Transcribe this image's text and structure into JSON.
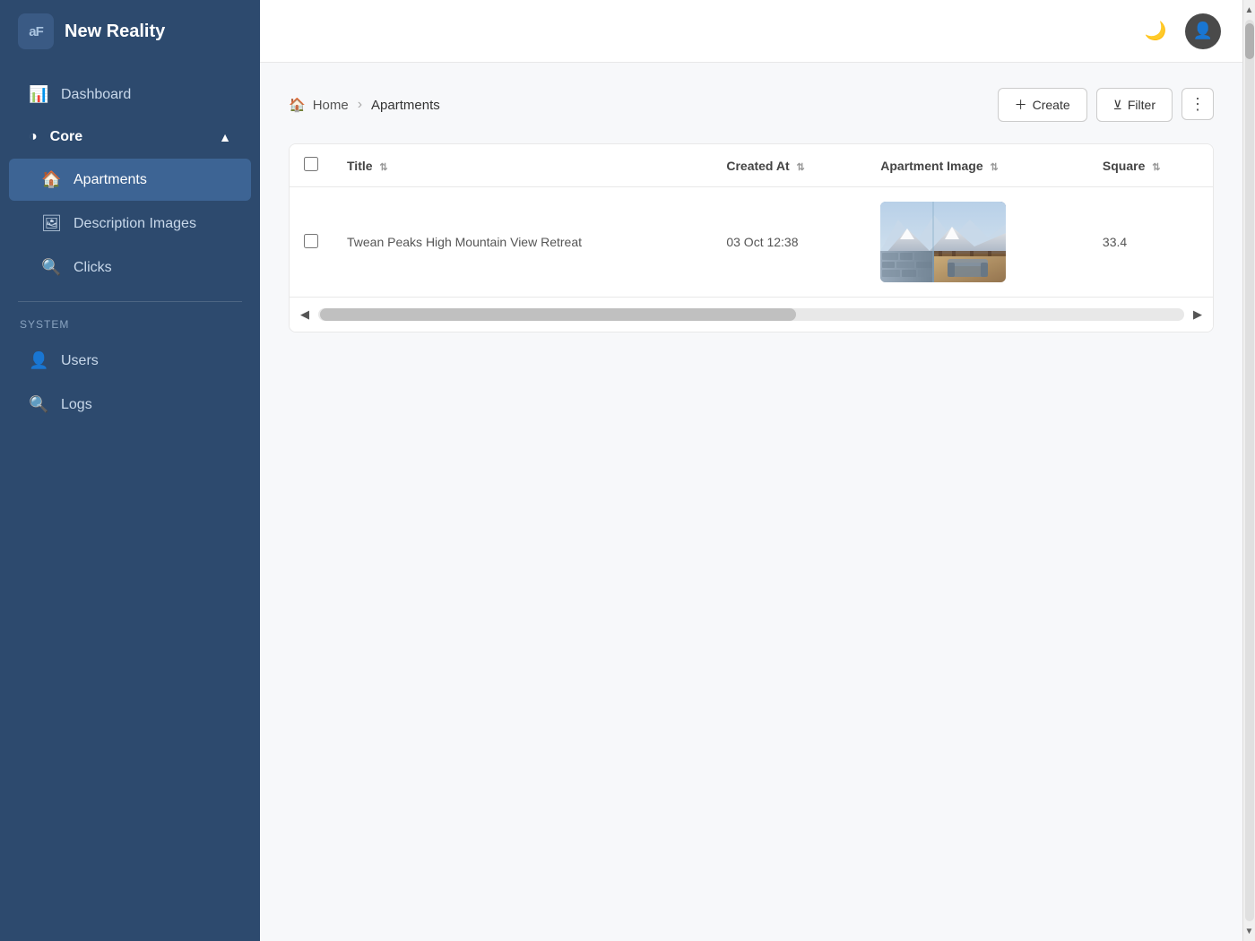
{
  "app": {
    "logo_text": "aF",
    "title": "New Reality"
  },
  "sidebar": {
    "nav_items": [
      {
        "id": "dashboard",
        "label": "Dashboard",
        "icon": "📊",
        "active": false
      },
      {
        "id": "core",
        "label": "Core",
        "icon": "◑",
        "active": false,
        "expandable": true,
        "expanded": true
      },
      {
        "id": "apartments",
        "label": "Apartments",
        "icon": "🏠",
        "active": true,
        "indent": true
      },
      {
        "id": "description-images",
        "label": "Description Images",
        "icon": "🖼",
        "active": false,
        "indent": true
      },
      {
        "id": "clicks",
        "label": "Clicks",
        "icon": "🔍",
        "active": false,
        "indent": true
      }
    ],
    "system_label": "SYSTEM",
    "system_items": [
      {
        "id": "users",
        "label": "Users",
        "icon": "👤"
      },
      {
        "id": "logs",
        "label": "Logs",
        "icon": "🔍"
      }
    ]
  },
  "topbar": {
    "dark_mode_icon": "🌙",
    "avatar_icon": "👤"
  },
  "breadcrumb": {
    "home_label": "Home",
    "separator": "›",
    "current": "Apartments",
    "create_label": "+ Create",
    "filter_label": "Filter",
    "more_icon": "⋮"
  },
  "table": {
    "columns": [
      {
        "id": "title",
        "label": "Title",
        "sortable": true
      },
      {
        "id": "created_at",
        "label": "Created At",
        "sortable": true
      },
      {
        "id": "apartment_image",
        "label": "Apartment Image",
        "sortable": true
      },
      {
        "id": "square",
        "label": "Square",
        "sortable": true
      }
    ],
    "rows": [
      {
        "id": 1,
        "title": "Twean Peaks High Mountain View Retreat",
        "created_at": "03 Oct 12:38",
        "has_image": true,
        "square": "33.4"
      }
    ]
  }
}
